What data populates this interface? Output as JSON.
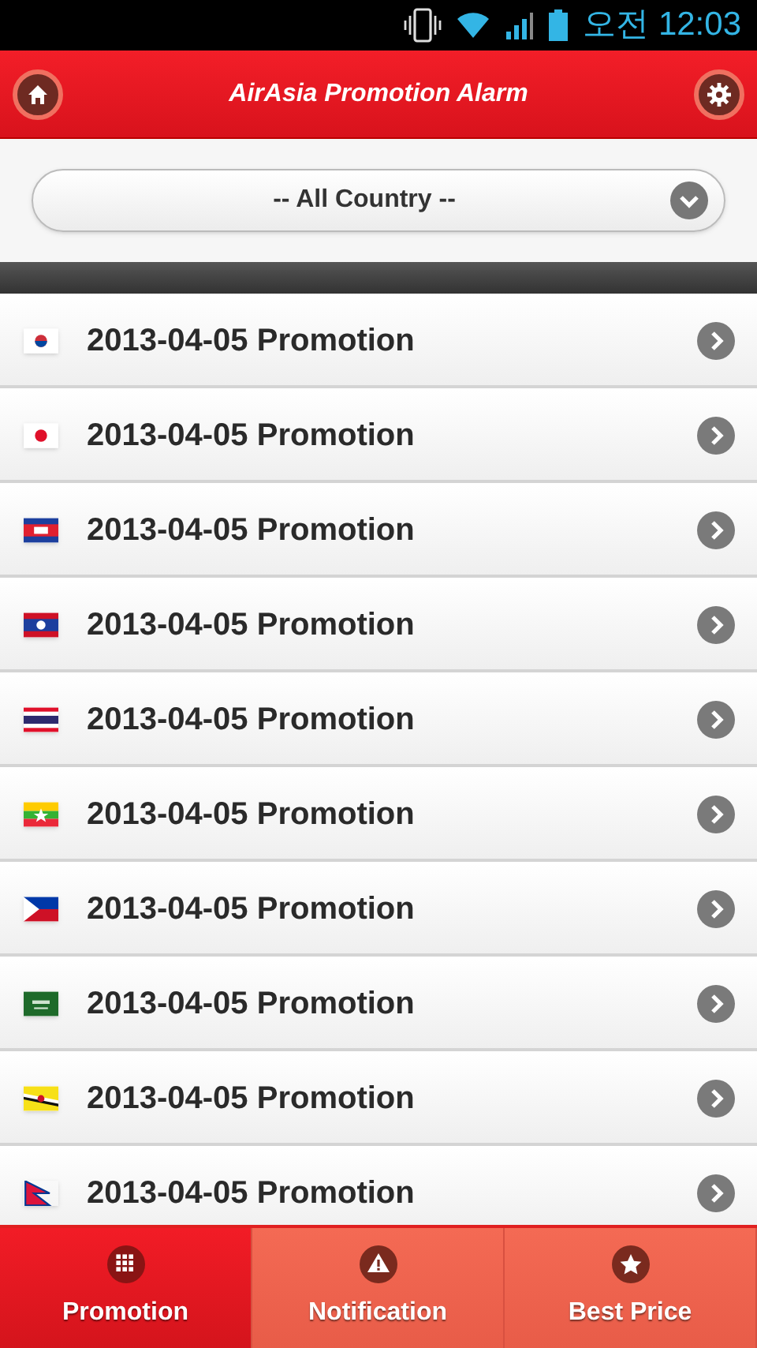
{
  "status_bar": {
    "time": "오전 12:03"
  },
  "header": {
    "title": "AirAsia Promotion Alarm"
  },
  "filter": {
    "value": "-- All Country --"
  },
  "promotions": [
    {
      "kind": "korea",
      "label": "2013-04-05 Promotion"
    },
    {
      "kind": "japan",
      "label": "2013-04-05 Promotion"
    },
    {
      "kind": "cambodia",
      "label": "2013-04-05 Promotion"
    },
    {
      "kind": "laos",
      "label": "2013-04-05 Promotion"
    },
    {
      "kind": "thailand",
      "label": "2013-04-05 Promotion"
    },
    {
      "kind": "myanmar",
      "label": "2013-04-05 Promotion"
    },
    {
      "kind": "philippines",
      "label": "2013-04-05 Promotion"
    },
    {
      "kind": "saudi",
      "label": "2013-04-05 Promotion"
    },
    {
      "kind": "brunei",
      "label": "2013-04-05 Promotion"
    },
    {
      "kind": "nepal",
      "label": "2013-04-05 Promotion"
    }
  ],
  "tabs": [
    {
      "kind": "grid",
      "label": "Promotion",
      "selected": true
    },
    {
      "kind": "warning",
      "label": "Notification",
      "selected": false
    },
    {
      "kind": "star",
      "label": "Best Price",
      "selected": false
    }
  ]
}
